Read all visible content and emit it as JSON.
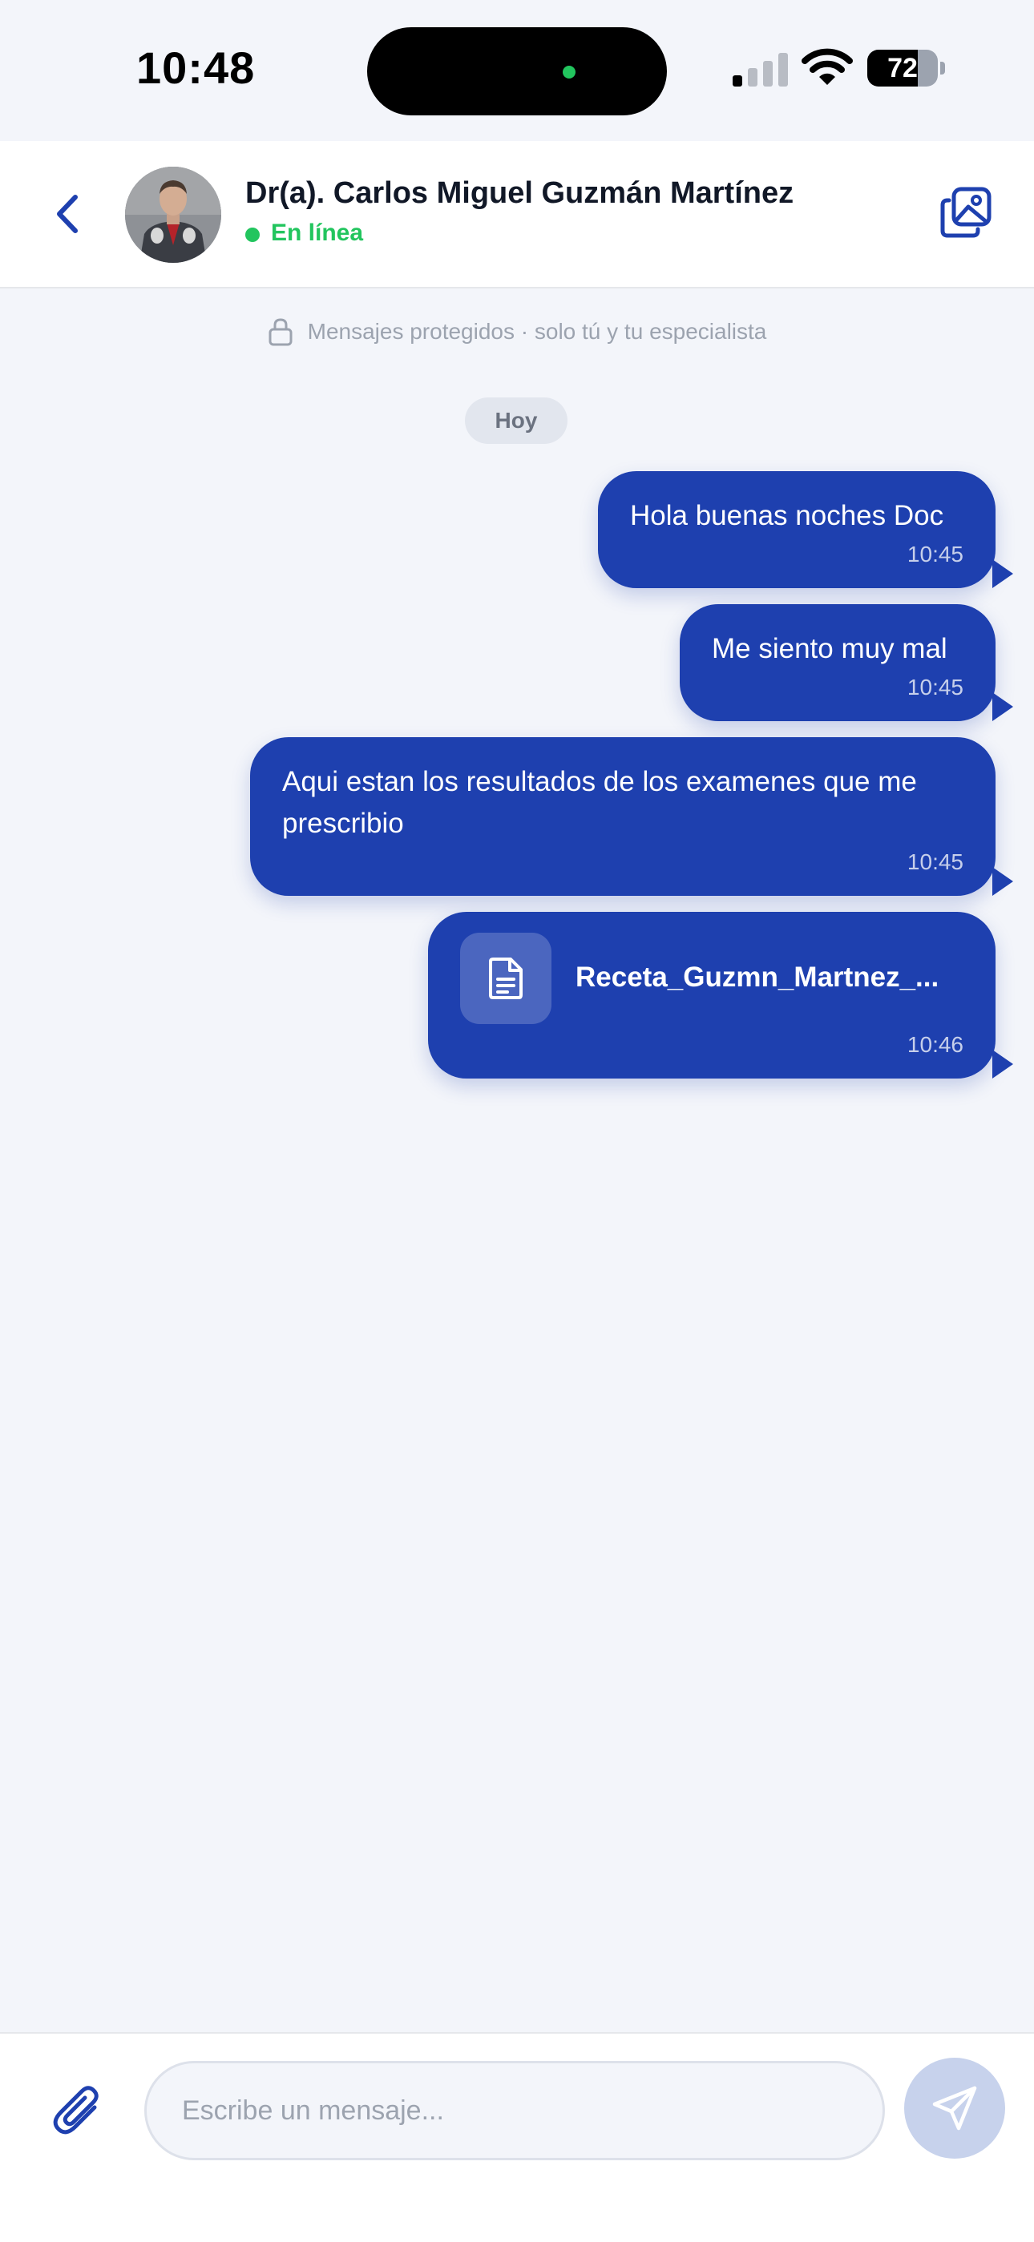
{
  "status_bar": {
    "time": "10:48",
    "battery": "72",
    "battery_level_percent": 72
  },
  "header": {
    "contact_name": "Dr(a). Carlos Miguel Guzmán Martínez",
    "status": "En línea"
  },
  "notice": "Mensajes protegidos · solo tú y tu especialista",
  "date_chip": "Hoy",
  "messages": [
    {
      "text": "Hola buenas noches Doc",
      "time": "10:45"
    },
    {
      "text": "Me siento muy mal",
      "time": "10:45"
    },
    {
      "text": "Aqui estan los resultados de los examenes que me prescribio",
      "time": "10:45"
    },
    {
      "file_name": "Receta_Guzmn_Martnez_...",
      "time": "10:46"
    }
  ],
  "composer": {
    "placeholder": "Escribe un mensaje..."
  },
  "colors": {
    "accent": "#1e40af",
    "online": "#22c55e",
    "background": "#f3f5fa"
  },
  "icons": {
    "back": "chevron-left-icon",
    "gallery": "image-gallery-icon",
    "lock": "lock-icon",
    "file": "document-icon",
    "attach": "paperclip-icon",
    "send": "send-icon"
  }
}
